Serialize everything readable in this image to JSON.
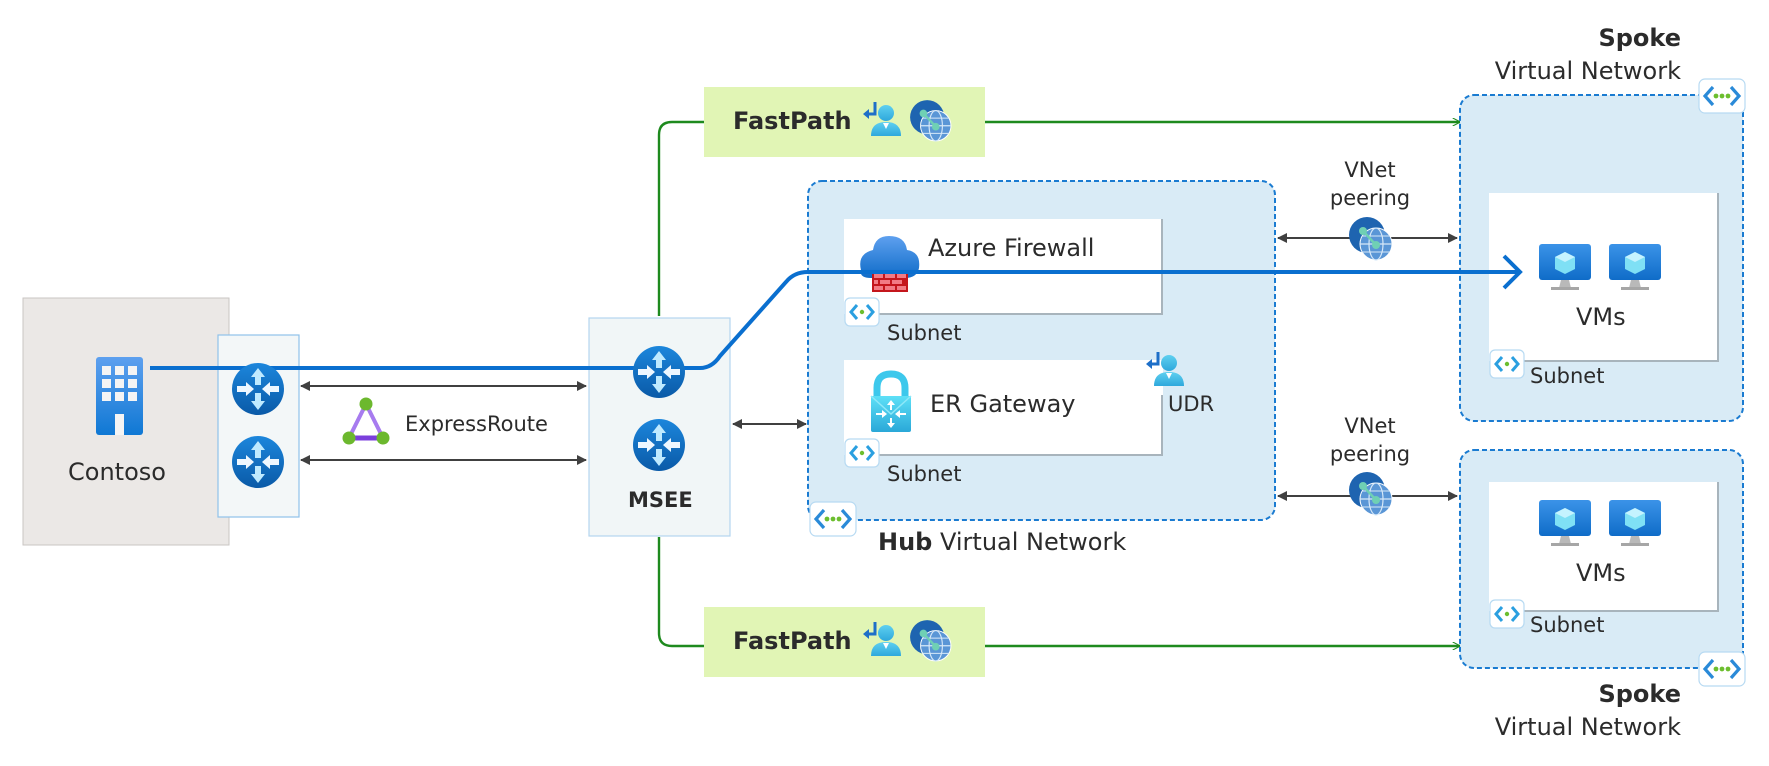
{
  "onprem": {
    "label": "Contoso"
  },
  "expressroute": {
    "label": "ExpressRoute"
  },
  "msee": {
    "label": "MSEE"
  },
  "fastpath_top": {
    "label": "FastPath"
  },
  "fastpath_bottom": {
    "label": "FastPath"
  },
  "hub": {
    "title_bold": "Hub",
    "title_rest": " Virtual Network",
    "firewall": {
      "label": "Azure Firewall",
      "subnet_label": "Subnet"
    },
    "gateway": {
      "label": "ER Gateway",
      "subnet_label": "Subnet",
      "udr_label": "UDR"
    }
  },
  "peering_top": {
    "line1": "VNet",
    "line2": "peering"
  },
  "peering_bottom": {
    "line1": "VNet",
    "line2": "peering"
  },
  "spoke_top": {
    "title_bold": "Spoke",
    "title_rest": "Virtual Network",
    "vms_label": "VMs",
    "subnet_label": "Subnet"
  },
  "spoke_bottom": {
    "title_bold": "Spoke",
    "title_rest": "Virtual Network",
    "vms_label": "VMs",
    "subnet_label": "Subnet"
  },
  "colors": {
    "traffic_path": "#0a6fcf",
    "fastpath_line": "#1e8a1e",
    "fastpath_fill": "#e1f5b5",
    "vnet_fill": "#d9ebf6",
    "vnet_border": "#1a7bd1",
    "connector": "#404040"
  }
}
